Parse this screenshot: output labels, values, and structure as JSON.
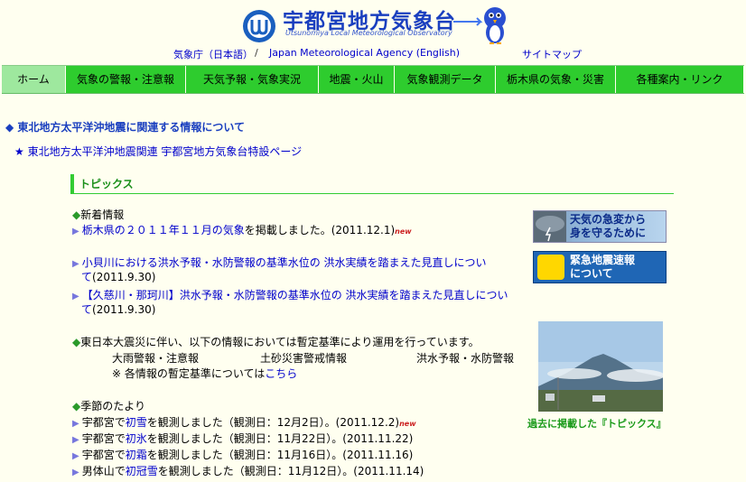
{
  "header": {
    "title": "宇都宮地方気象台",
    "subtitle": "Utsunomiya Local Meteorological Observatory",
    "link_jma": "気象庁（日本語）",
    "separator": "/",
    "link_english": "Japan Meteorological Agency (English)",
    "link_sitemap": "サイトマップ"
  },
  "nav": [
    {
      "label": "ホーム"
    },
    {
      "label": "気象の警報・注意報"
    },
    {
      "label": "天気予報・気象実況"
    },
    {
      "label": "地震・火山"
    },
    {
      "label": "気象観測データ"
    },
    {
      "label": "栃木県の気象・災害"
    },
    {
      "label": "各種案内・リンク"
    }
  ],
  "alerts": {
    "quake_info": "◆ 東北地方太平洋沖地震に関連する情報について",
    "special_page": "★ 東北地方太平洋沖地震関連 宇都宮地方気象台特設ページ"
  },
  "topics": {
    "heading": "トピックス",
    "new_label": "新着情報",
    "new_mark": "new",
    "item1": "栃木県の２０１１年１１月の気象",
    "item1_suffix": "を掲載しました。(2011.12.1)",
    "item2_line1": "小貝川における洪水予報・水防警報の基準水位の 洪水実績を踏まえた見直しについ",
    "item2_line2": "て",
    "item2_date": "(2011.9.30)",
    "item3_line1": "【久慈川・那珂川】洪水予報・水防警報の基準水位の 洪水実績を踏まえた見直しについ",
    "item3_line2": "て",
    "item3_date": "(2011.9.30)",
    "quake_notice": "東日本大震災に伴い、以下の情報においては暫定基準により運用を行っています。",
    "prov1": "大雨警報・注意報",
    "prov2": "土砂災害警戒情報",
    "prov3": "洪水予報・水防警報",
    "prov_note": "※ 各情報の暫定基準については",
    "prov_link": "こちら",
    "season_label": "季節のたより",
    "s1_a": "宇都宮で",
    "s1_link": "初雪",
    "s1_b": "を観測しました（観測日：12月2日）。(2011.12.2)",
    "s2_a": "宇都宮で",
    "s2_link": "初氷",
    "s2_b": "を観測しました（観測日：11月22日）。(2011.11.22)",
    "s3_a": "宇都宮で",
    "s3_link": "初霜",
    "s3_b": "を観測しました（観測日：11月16日）。(2011.11.16)",
    "s4_a": "男体山で",
    "s4_link": "初冠雪",
    "s4_b": "を観測しました（観測日：11月12日）。(2011.11.14)"
  },
  "side": {
    "banner1_line1": "天気の急変から",
    "banner1_line2": "身を守るために",
    "banner2_line1": "緊急地震速報",
    "banner2_line2": "について",
    "photo_caption": "過去に掲載した『トピックス』"
  }
}
